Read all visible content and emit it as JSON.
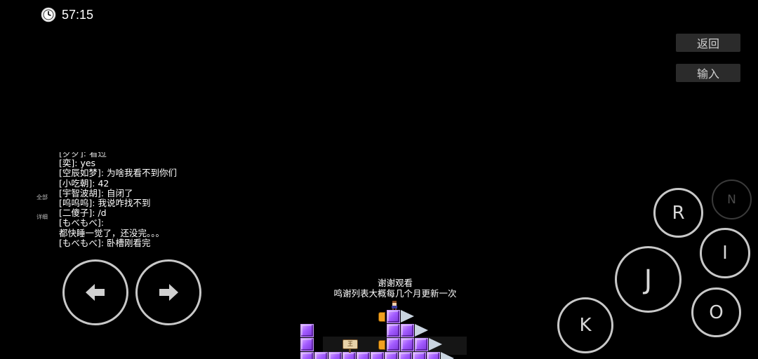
{
  "timer": {
    "time": "57:15",
    "icon": "clock-icon"
  },
  "menu": {
    "back_label": "返回",
    "input_label": "输入"
  },
  "chat_tabs": {
    "all": "全部",
    "detail": "详细"
  },
  "chat": {
    "partial_top": "[歹歹]: 看过",
    "messages": [
      "[奕]: yes",
      "[空辰如梦]: 为啥我看不到你们",
      "[小吃朝]: 42",
      "[宇智波胡]: 自闭了",
      "[呜呜呜]: 我说咋找不到",
      "[二傻子]: /d",
      "[もべもべ]:",
      "都快睡一觉了，还没完。。。",
      "[もべもべ]: 卧槽刚看完"
    ]
  },
  "controls": {
    "left_icon": "arrow-left-icon",
    "right_icon": "arrow-right-icon",
    "r": "R",
    "n": "N",
    "i": "I",
    "j": "J",
    "k": "K",
    "o": "O"
  },
  "stage": {
    "line1": "谢谢观看",
    "line2": "鸣谢列表大概每几个月更新一次",
    "sign_text": "王"
  },
  "colors": {
    "background": "#000000",
    "button_border": "#c8c8c8",
    "block_purple": "#a35cff"
  }
}
